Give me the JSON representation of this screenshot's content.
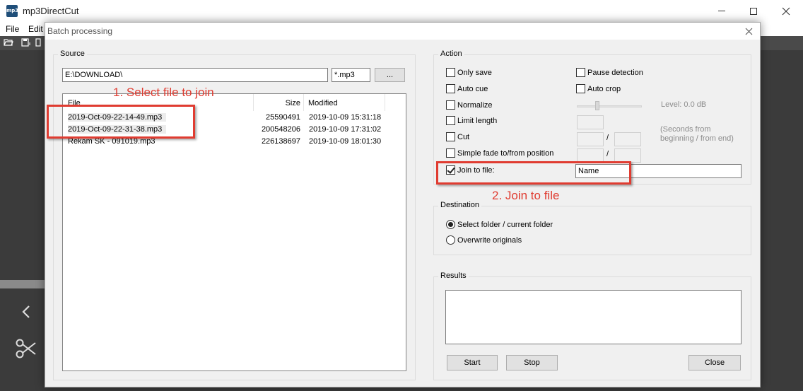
{
  "app": {
    "title": "mp3DirectCut",
    "icon_text": "mp3",
    "menu": [
      "File",
      "Edit"
    ]
  },
  "dialog": {
    "title": "Batch processing",
    "source": {
      "legend": "Source",
      "path": "E:\\DOWNLOAD\\",
      "filter": "*.mp3",
      "browse_label": "...",
      "columns": [
        "File",
        "Size",
        "Modified"
      ],
      "files": [
        {
          "name": "2019-Oct-09-22-14-49.mp3",
          "size": "25590491",
          "modified": "2019-10-09  15:31:18",
          "selected": true
        },
        {
          "name": "2019-Oct-09-22-31-38.mp3",
          "size": "200548206",
          "modified": "2019-10-09  17:31:02",
          "selected": true
        },
        {
          "name": "Rekam SK - 091019.mp3",
          "size": "226138697",
          "modified": "2019-10-09  18:01:30",
          "selected": false
        }
      ]
    },
    "action": {
      "legend": "Action",
      "only_save": "Only save",
      "auto_cue": "Auto cue",
      "normalize": "Normalize",
      "limit_length": "Limit length",
      "cut": "Cut",
      "simple_fade": "Simple fade to/from position",
      "join_to_file": "Join to file:",
      "join_to_file_checked": true,
      "pause_detection": "Pause detection",
      "auto_crop": "Auto crop",
      "level_text": "Level: 0.0 dB",
      "slash": "/",
      "seconds_note_1": "(Seconds from",
      "seconds_note_2": "beginning / from end)",
      "join_name": "Name"
    },
    "destination": {
      "legend": "Destination",
      "option_select": "Select folder / current folder",
      "option_overwrite": "Overwrite originals",
      "selected": "Select folder / current folder"
    },
    "results": {
      "legend": "Results",
      "start": "Start",
      "stop": "Stop",
      "close": "Close"
    }
  },
  "annotations": {
    "step1": "1. Select file to join",
    "step2": "2. Join to file",
    "color": "#e03c31"
  }
}
